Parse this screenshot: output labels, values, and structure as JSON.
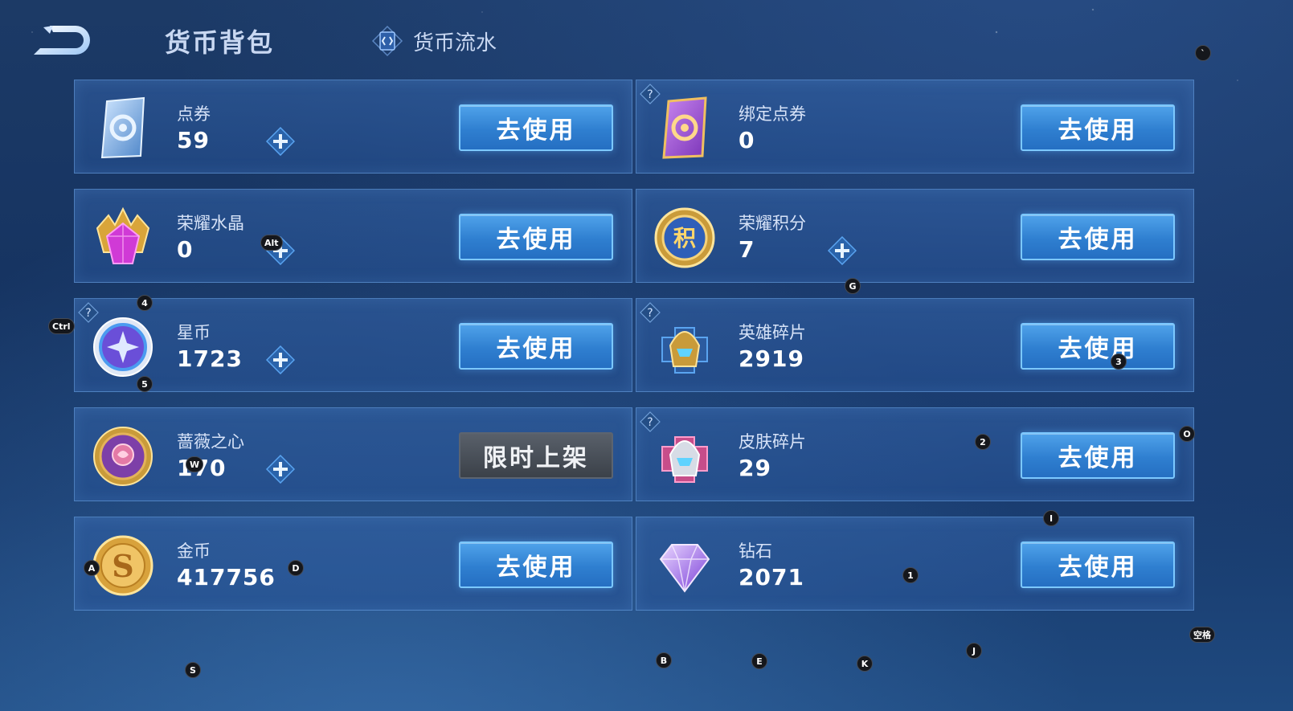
{
  "header": {
    "title": "货币背包",
    "flow_label": "货币流水"
  },
  "currencies": [
    {
      "name": "点券",
      "value": "59",
      "action": "去使用",
      "has_plus": true,
      "has_help": false,
      "icon": "voucher-icon"
    },
    {
      "name": "绑定点券",
      "value": "0",
      "action": "去使用",
      "has_plus": false,
      "has_help": true,
      "icon": "bound-voucher-icon"
    },
    {
      "name": "荣耀水晶",
      "value": "0",
      "action": "去使用",
      "has_plus": true,
      "has_help": false,
      "icon": "glory-crystal-icon"
    },
    {
      "name": "荣耀积分",
      "value": "7",
      "action": "去使用",
      "has_plus": true,
      "has_help": false,
      "icon": "glory-points-icon"
    },
    {
      "name": "星币",
      "value": "1723",
      "action": "去使用",
      "has_plus": true,
      "has_help": true,
      "icon": "star-coin-icon"
    },
    {
      "name": "英雄碎片",
      "value": "2919",
      "action": "去使用",
      "has_plus": false,
      "has_help": true,
      "icon": "hero-fragment-icon"
    },
    {
      "name": "蔷薇之心",
      "value": "170",
      "action": "限时上架",
      "has_plus": true,
      "has_help": false,
      "icon": "rose-heart-icon"
    },
    {
      "name": "皮肤碎片",
      "value": "29",
      "action": "去使用",
      "has_plus": false,
      "has_help": true,
      "icon": "skin-fragment-icon"
    },
    {
      "name": "金币",
      "value": "417756",
      "action": "去使用",
      "has_plus": false,
      "has_help": false,
      "icon": "gold-coin-icon"
    },
    {
      "name": "钻石",
      "value": "2071",
      "action": "去使用",
      "has_plus": false,
      "has_help": false,
      "icon": "diamond-icon"
    }
  ],
  "key_hints": [
    "`",
    "Alt",
    "G",
    "4",
    "Ctrl",
    "5",
    "3",
    "2",
    "O",
    "W",
    "I",
    "A",
    "D",
    "1",
    "空格",
    "J",
    "B",
    "E",
    "K",
    "S"
  ],
  "colors": {
    "accent": "#2f7fd0",
    "accent_border": "#7cc8ff",
    "card_border": "#6ea5e6",
    "disabled_button": "#4a5059",
    "background": "#163462"
  }
}
